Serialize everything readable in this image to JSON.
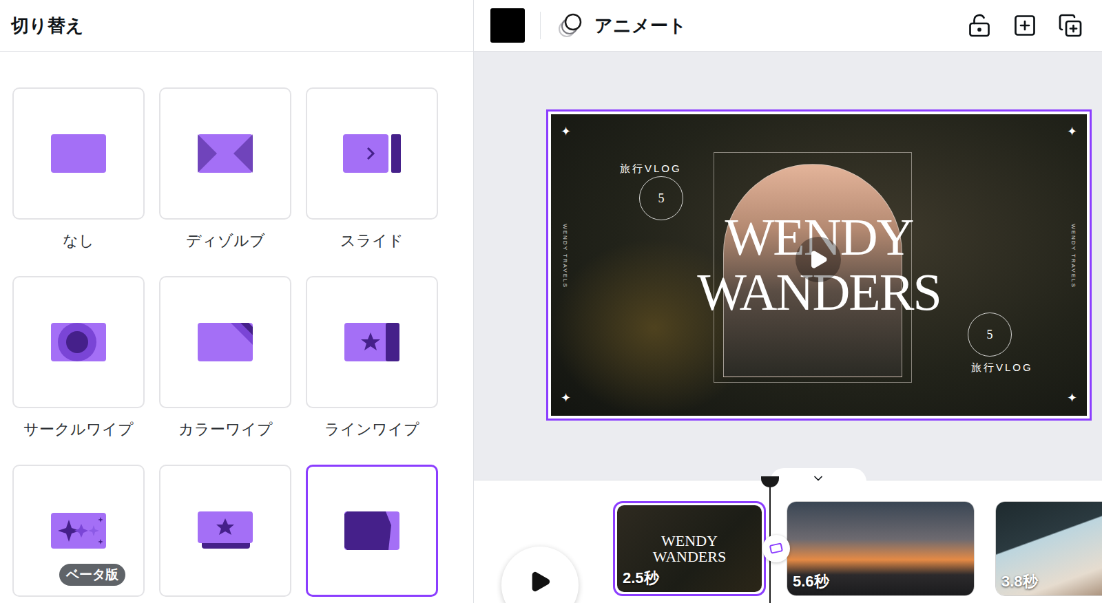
{
  "panel": {
    "title": "切り替え"
  },
  "transitions": [
    {
      "label": "なし",
      "kind": "none",
      "selected": false
    },
    {
      "label": "ディゾルブ",
      "kind": "dissolve",
      "selected": false
    },
    {
      "label": "スライド",
      "kind": "slide",
      "selected": false
    },
    {
      "label": "サークルワイプ",
      "kind": "circle",
      "selected": false
    },
    {
      "label": "カラーワイプ",
      "kind": "color",
      "selected": false
    },
    {
      "label": "ラインワイプ",
      "kind": "line",
      "selected": false
    },
    {
      "kind": "sparkle",
      "badge": "ベータ版",
      "selected": false
    },
    {
      "kind": "rise",
      "selected": false
    },
    {
      "kind": "tilt",
      "selected": true
    }
  ],
  "toolbar": {
    "animate": "アニメート"
  },
  "design": {
    "title": [
      "WENDY",
      "WANDERS"
    ],
    "badge_text": "旅行VLOG",
    "badge_number": "5",
    "side_text": "WENDY TRAVELS",
    "star": "✦"
  },
  "timeline": {
    "pages": [
      {
        "duration": "2.5秒",
        "kind": "title",
        "selected": true
      },
      {
        "duration": "5.6秒",
        "kind": "sunset",
        "selected": false
      },
      {
        "duration": "3.8秒",
        "kind": "pier",
        "selected": false
      }
    ]
  }
}
